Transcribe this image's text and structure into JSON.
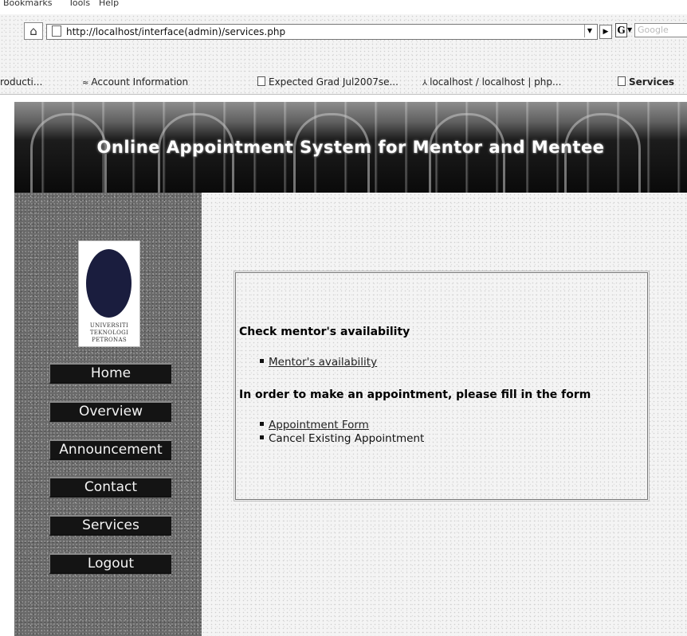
{
  "browser": {
    "menu": [
      "Bookmarks",
      "Tools",
      "Help"
    ],
    "url": "http://localhost/interface(admin)/services.php",
    "search_placeholder": "Google"
  },
  "bookmarks": [
    "roducti...",
    "Account Information",
    "Expected Grad Jul2007se...",
    "localhost / localhost | php...",
    "Services"
  ],
  "banner": {
    "title": "Online Appointment System for Mentor and Mentee"
  },
  "logo": {
    "text": "UNIVERSITI\nTEKNOLOGI\nPETRONAS"
  },
  "nav": [
    "Home",
    "Overview",
    "Announcement",
    "Contact",
    "Services",
    "Logout"
  ],
  "content": {
    "heading1": "Check mentor's availability",
    "link_availability": "Mentor's availability",
    "heading2": "In order to make an appointment, please fill in the form",
    "link_form": "Appointment Form",
    "cancel_text": "Cancel Existing Appointment"
  }
}
